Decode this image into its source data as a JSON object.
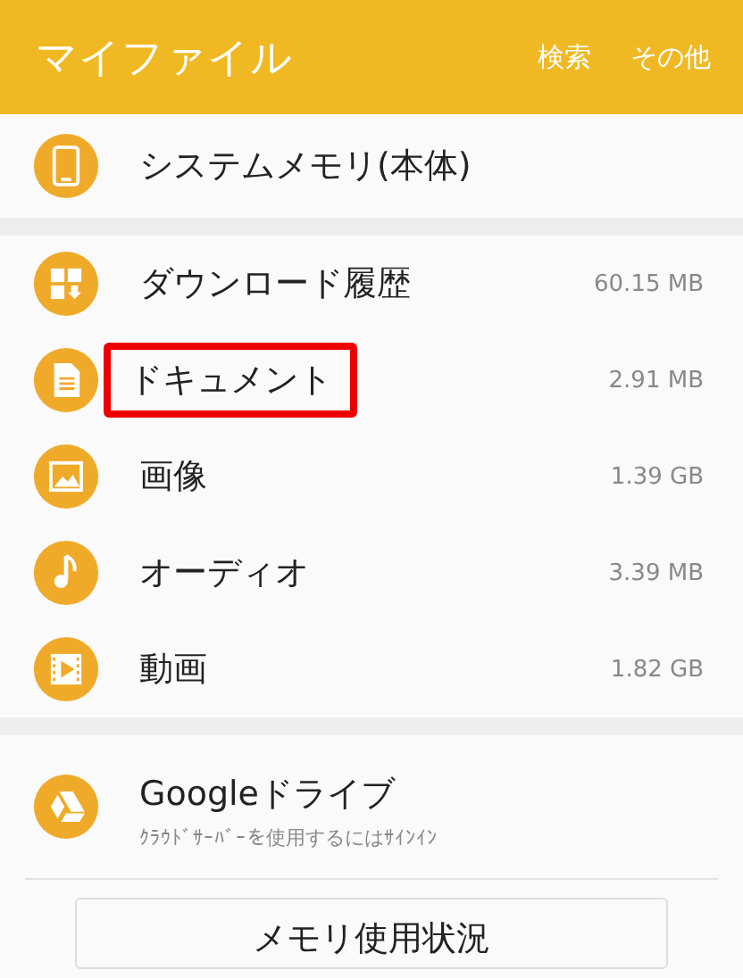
{
  "header": {
    "title": "マイファイル",
    "actions": [
      "検索",
      "その他"
    ]
  },
  "system_memory": {
    "label": "システムメモリ(本体)"
  },
  "categories": [
    {
      "label": "ダウンロード履歴",
      "size": "60.15 MB",
      "highlighted": false
    },
    {
      "label": "ドキュメント",
      "size": "2.91 MB",
      "highlighted": true
    },
    {
      "label": "画像",
      "size": "1.39 GB",
      "highlighted": false
    },
    {
      "label": "オーディオ",
      "size": "3.39 MB",
      "highlighted": false
    },
    {
      "label": "動画",
      "size": "1.82 GB",
      "highlighted": false
    }
  ],
  "cloud": {
    "label": "Googleドライブ",
    "subtitle": "ｸﾗｳﾄﾞｻｰﾊﾞｰを使用するにはｻｲﾝｲﾝ"
  },
  "button": {
    "label": "メモリ使用状況"
  }
}
